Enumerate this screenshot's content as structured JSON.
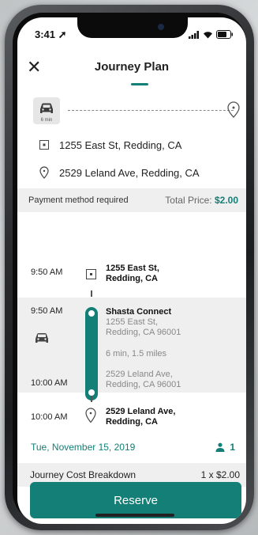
{
  "status": {
    "time": "3:41"
  },
  "header": {
    "title": "Journey Plan",
    "close_icon": "close-icon"
  },
  "route": {
    "car_minutes": "6 min",
    "origin": "1255 East St, Redding, CA",
    "destination": "2529 Leland Ave, Redding, CA"
  },
  "payment": {
    "method_label": "Payment method required",
    "total_label": "Total Price:",
    "total_value": "$2.00"
  },
  "timeline": {
    "start": {
      "time": "9:50 AM",
      "name_line1": "1255 East St,",
      "name_line2": "Redding, CA"
    },
    "service": {
      "start_time": "9:50 AM",
      "end_time": "10:00 AM",
      "name": "Shasta Connect",
      "from_line1": "1255 East St,",
      "from_line2": "Redding, CA 96001",
      "duration": "6 min, 1.5 miles",
      "to_line1": "2529 Leland Ave,",
      "to_line2": "Redding, CA 96001"
    },
    "end": {
      "time": "10:00 AM",
      "name_line1": "2529 Leland Ave,",
      "name_line2": "Redding, CA"
    }
  },
  "trip": {
    "date": "Tue, November 15, 2019",
    "passengers": "1"
  },
  "cost": {
    "label": "Journey Cost Breakdown",
    "value": "1 x $2.00"
  },
  "actions": {
    "reserve": "Reserve"
  },
  "colors": {
    "accent": "#137f76"
  }
}
